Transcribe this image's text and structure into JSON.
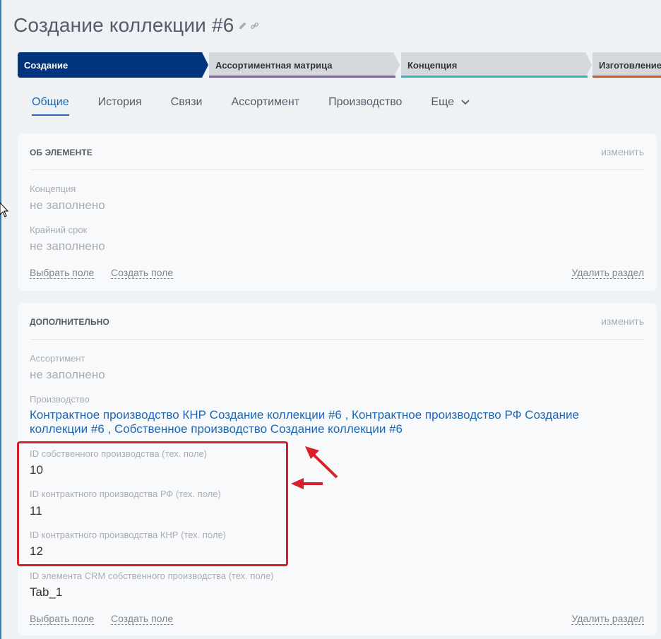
{
  "page": {
    "title": "Создание коллекции #6"
  },
  "stages": [
    {
      "label": "Создание",
      "color": "#00347c",
      "text_color": "#ffffff"
    },
    {
      "label": "Ассортиментная матрица",
      "color": "#d5d9de",
      "accent": "#7d5fb3"
    },
    {
      "label": "Концепция",
      "color": "#d5d9de",
      "accent": "#2fb9bd"
    },
    {
      "label": "Изготовление",
      "color": "#d5d9de",
      "accent": "#d3561f"
    }
  ],
  "tabs": [
    {
      "label": "Общие"
    },
    {
      "label": "История"
    },
    {
      "label": "Связи"
    },
    {
      "label": "Ассортимент"
    },
    {
      "label": "Производство"
    },
    {
      "label": "Еще"
    }
  ],
  "about": {
    "title": "ОБ ЭЛЕМЕНТЕ",
    "edit": "изменить",
    "fields": [
      {
        "label": "Концепция",
        "value": "не заполнено"
      },
      {
        "label": "Крайний срок",
        "value": "не заполнено"
      }
    ],
    "select_field": "Выбрать поле",
    "create_field": "Создать поле",
    "delete_section": "Удалить раздел"
  },
  "extra": {
    "title": "ДОПОЛНИТЕЛЬНО",
    "edit": "изменить",
    "assortment": {
      "label": "Ассортимент",
      "value": "не заполнено"
    },
    "production": {
      "label": "Производство",
      "value": "Контрактное производство КНР Создание коллекции #6 , Контрактное производство РФ Создание коллекции #6 , Собственное производство Создание коллекции #6"
    },
    "own_id": {
      "label": "ID собственного производства (тех. поле)",
      "value": "10"
    },
    "rf_id": {
      "label": "ID контрактного производства РФ (тех. поле)",
      "value": "11"
    },
    "knr_id": {
      "label": "ID контрактного производства КНР (тех. поле)",
      "value": "12"
    },
    "crm_id": {
      "label": "ID элемента CRM собственного производства (тех. поле)",
      "value": "Tab_1"
    },
    "select_field": "Выбрать поле",
    "create_field": "Создать поле",
    "delete_section": "Удалить раздел"
  },
  "colors": {
    "accent_blue": "#2067b0",
    "highlight_red": "#d9202a"
  }
}
